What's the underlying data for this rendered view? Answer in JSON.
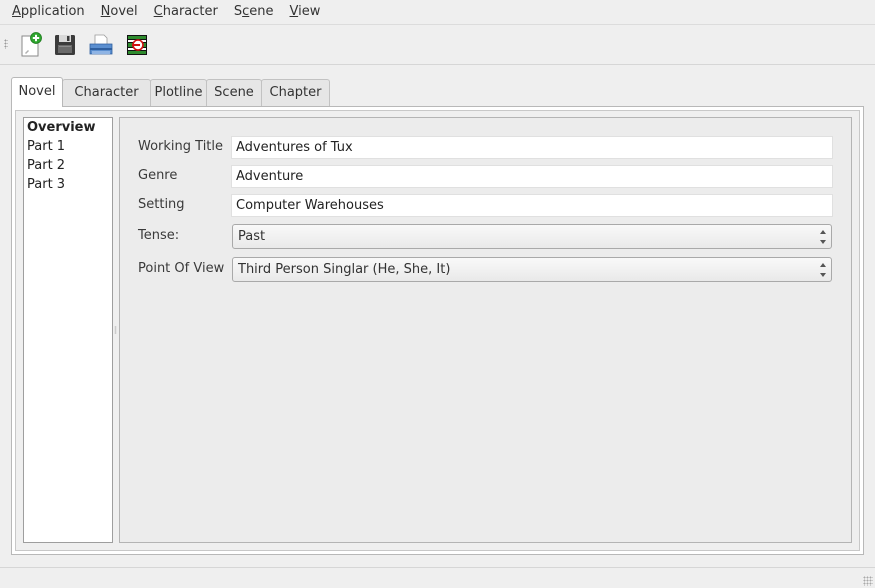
{
  "menubar": {
    "items": [
      {
        "label": "Application",
        "mnemonic_index": 0
      },
      {
        "label": "Novel",
        "mnemonic_index": 0
      },
      {
        "label": "Character",
        "mnemonic_index": 0
      },
      {
        "label": "Scene",
        "mnemonic_index": 1
      },
      {
        "label": "View",
        "mnemonic_index": 0
      }
    ]
  },
  "toolbar": {
    "buttons": [
      {
        "icon": "new-document-icon"
      },
      {
        "icon": "save-icon"
      },
      {
        "icon": "print-icon"
      },
      {
        "icon": "exit-icon"
      }
    ]
  },
  "tabs": {
    "items": [
      {
        "label": "Novel",
        "active": true
      },
      {
        "label": "Character",
        "active": false
      },
      {
        "label": "Plotline",
        "active": false
      },
      {
        "label": "Scene",
        "active": false
      },
      {
        "label": "Chapter",
        "active": false
      }
    ]
  },
  "outline": {
    "items": [
      {
        "label": "Overview",
        "bold": true
      },
      {
        "label": "Part 1",
        "bold": false
      },
      {
        "label": "Part 2",
        "bold": false
      },
      {
        "label": "Part 3",
        "bold": false
      }
    ]
  },
  "form": {
    "working_title": {
      "label": "Working Title",
      "value": "Adventures of Tux"
    },
    "genre": {
      "label": "Genre",
      "value": "Adventure"
    },
    "setting": {
      "label": "Setting",
      "value": "Computer Warehouses"
    },
    "tense": {
      "label": "Tense:",
      "value": "Past"
    },
    "point_of_view": {
      "label": "Point Of View",
      "value": "Third Person Singlar (He, She, It)"
    }
  }
}
